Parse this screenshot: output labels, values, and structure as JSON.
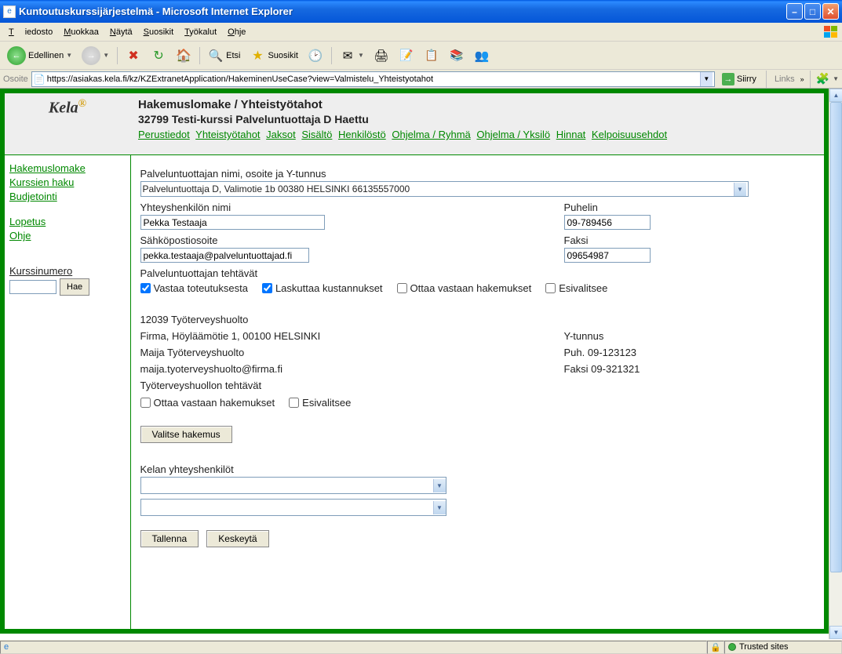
{
  "window": {
    "title": "Kuntoutuskurssijärjestelmä - Microsoft Internet Explorer"
  },
  "menu": {
    "file": "Tiedosto",
    "edit": "Muokkaa",
    "view": "Näytä",
    "favorites": "Suosikit",
    "tools": "Työkalut",
    "help": "Ohje"
  },
  "toolbar": {
    "back": "Edellinen",
    "search": "Etsi",
    "favorites": "Suosikit"
  },
  "addressbar": {
    "label": "Osoite",
    "url": "https://asiakas.kela.fi/kz/KZExtranetApplication/HakeminenUseCase?view=Valmistelu_Yhteistyotahot",
    "go": "Siirry",
    "links": "Links"
  },
  "app": {
    "logo": "Kela",
    "headerTitle": "Hakemuslomake / Yhteistyötahot",
    "headerSubtitle": "32799 Testi-kurssi Palveluntuottaja D Haettu",
    "tabs": [
      "Perustiedot",
      "Yhteistyötahot",
      "Jaksot",
      "Sisältö",
      "Henkilöstö",
      "Ohjelma / Ryhmä",
      "Ohjelma / Yksilö",
      "Hinnat",
      "Kelpoisuusehdot"
    ]
  },
  "sidebar": {
    "hakemuslomake": "Hakemuslomake",
    "kurssienhaku": "Kurssien haku",
    "budjetointi": "Budjetointi",
    "lopetus": "Lopetus",
    "ohje": "Ohje",
    "kurssinumero": "Kurssinumero",
    "hae": "Hae"
  },
  "form": {
    "providerLabel": "Palveluntuottajan nimi, osoite ja Y-tunnus",
    "providerValue": "Palveluntuottaja D, Valimotie 1b 00380 HELSINKI 66135557000",
    "contactNameLabel": "Yhteyshenkilön nimi",
    "contactNameValue": "Pekka Testaaja",
    "phoneLabel": "Puhelin",
    "phoneValue": "09-789456",
    "emailLabel": "Sähköpostiosoite",
    "emailValue": "pekka.testaaja@palveluntuottajad.fi",
    "faxLabel": "Faksi",
    "faxValue": "09654987",
    "tasksLabel": "Palveluntuottajan tehtävät",
    "chk1": "Vastaa toteutuksesta",
    "chk2": "Laskuttaa kustannukset",
    "chk3": "Ottaa vastaan hakemukset",
    "chk4": "Esivalitsee",
    "info1": "12039 Työterveyshuolto",
    "info2": "Firma, Höyläämötie 1, 00100 HELSINKI",
    "info2r": "Y-tunnus",
    "info3": "Maija Työterveyshuolto",
    "info3r": "Puh. 09-123123",
    "info4": "maija.tyoterveyshuolto@firma.fi",
    "info4r": "Faksi 09-321321",
    "tthTasks": "Työterveyshuollon tehtävät",
    "tthChk1": "Ottaa vastaan hakemukset",
    "tthChk2": "Esivalitsee",
    "valitseHakemus": "Valitse hakemus",
    "kelanLabel": "Kelan yhteyshenkilöt",
    "tallenna": "Tallenna",
    "keskeyta": "Keskeytä"
  },
  "statusbar": {
    "trusted": "Trusted sites"
  }
}
